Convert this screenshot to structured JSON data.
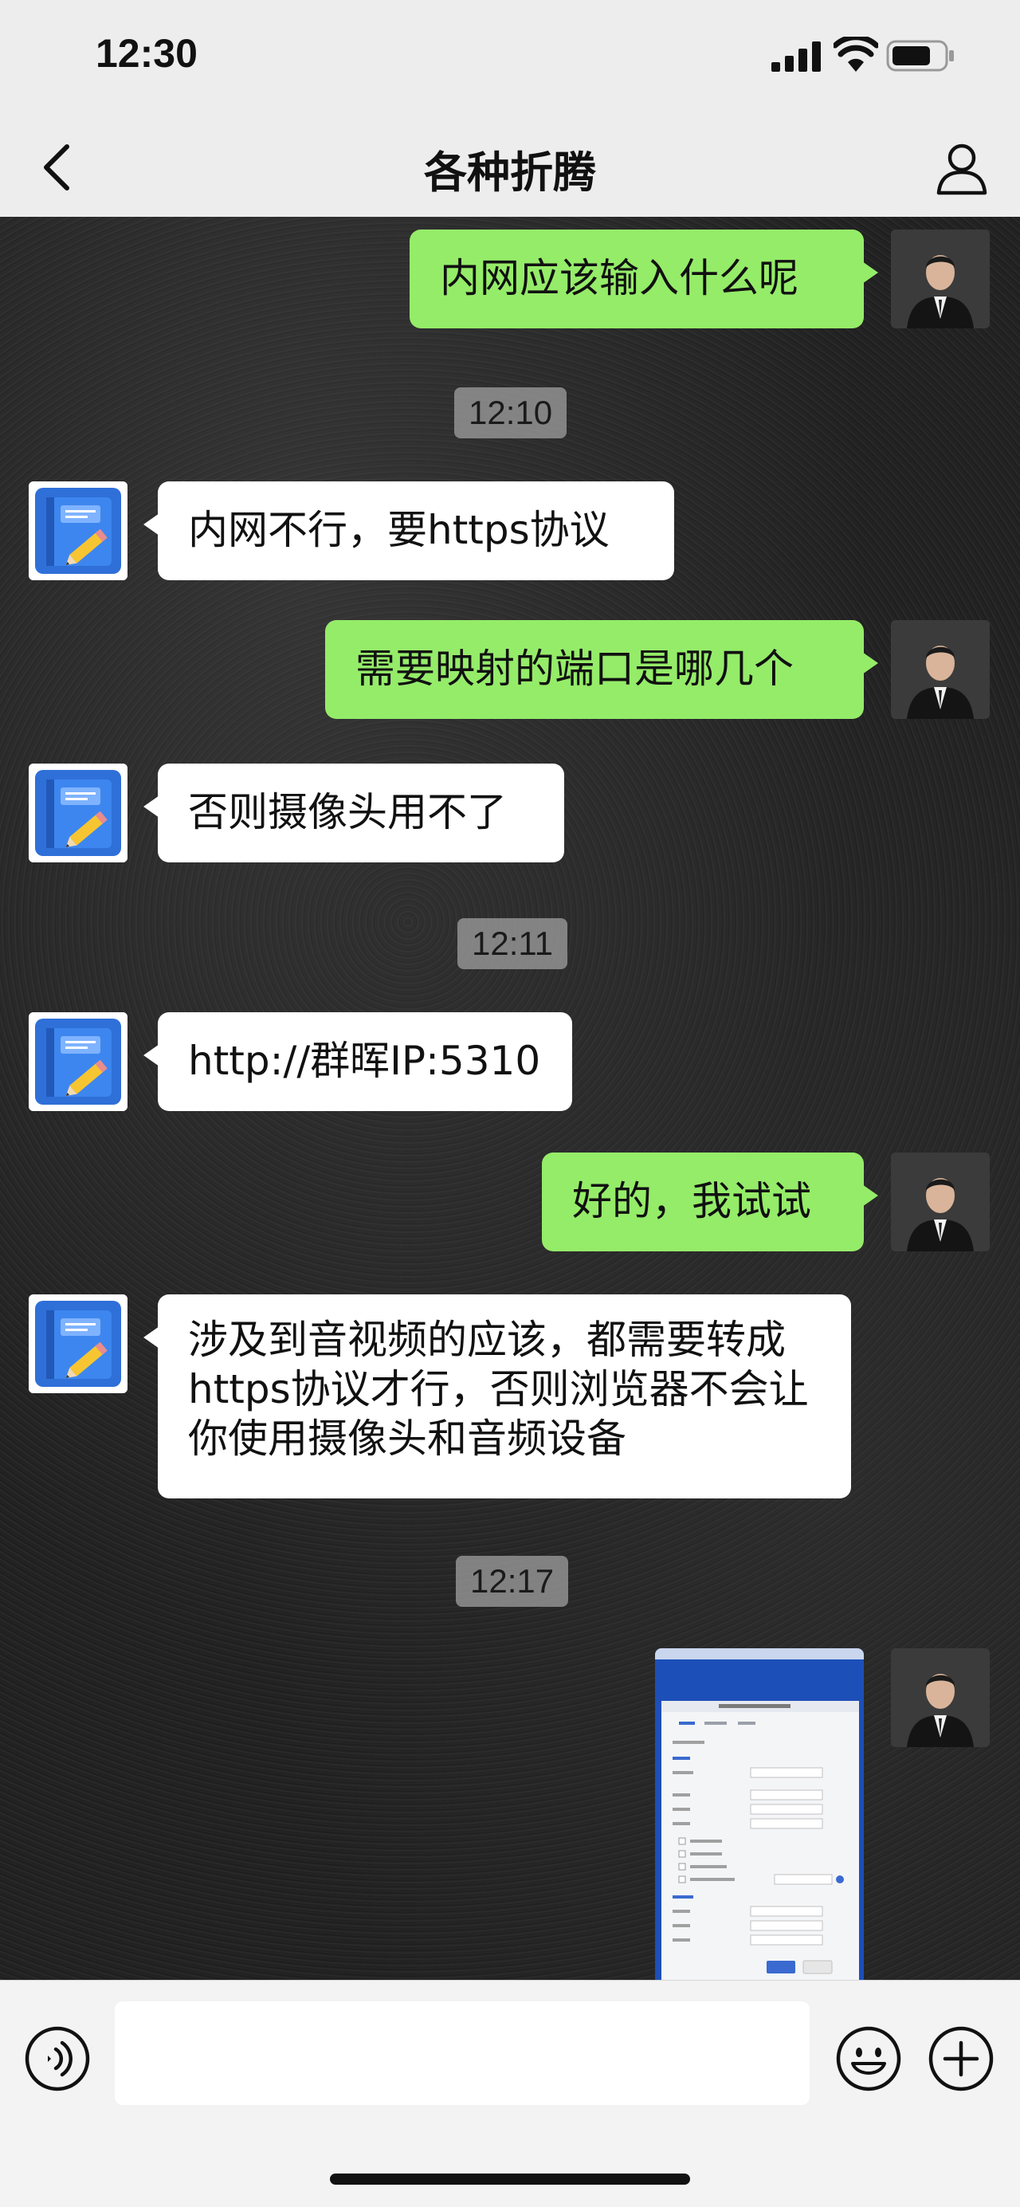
{
  "status_bar": {
    "time": "12:30",
    "battery_level": 0.75
  },
  "nav": {
    "title": "各种折腾"
  },
  "messages": {
    "m1": "内网应该输入什么呢",
    "t1": "12:10",
    "m2": "内网不行，要https协议",
    "m3": "需要映射的端口是哪几个",
    "m4": "否则摄像头用不了",
    "t2": "12:11",
    "m5": "http://群晖IP:5310",
    "m6": "好的，我试试",
    "m7": "涉及到音视频的应该，都需要转成https协议才行，否则浏览器不会让你使用摄像头和音频设备",
    "t3": "12:17"
  },
  "colors": {
    "my_bubble": "#95ec69",
    "other_bubble": "#ffffff",
    "chat_background": "#202020",
    "screenshot_blue": "#1d4fb8"
  },
  "icons": {
    "back": "chevron-left-icon",
    "profile": "person-icon",
    "voice": "voice-icon",
    "emoji": "emoji-icon",
    "plus": "plus-icon",
    "bot_avatar": "notebook-pencil-icon"
  }
}
